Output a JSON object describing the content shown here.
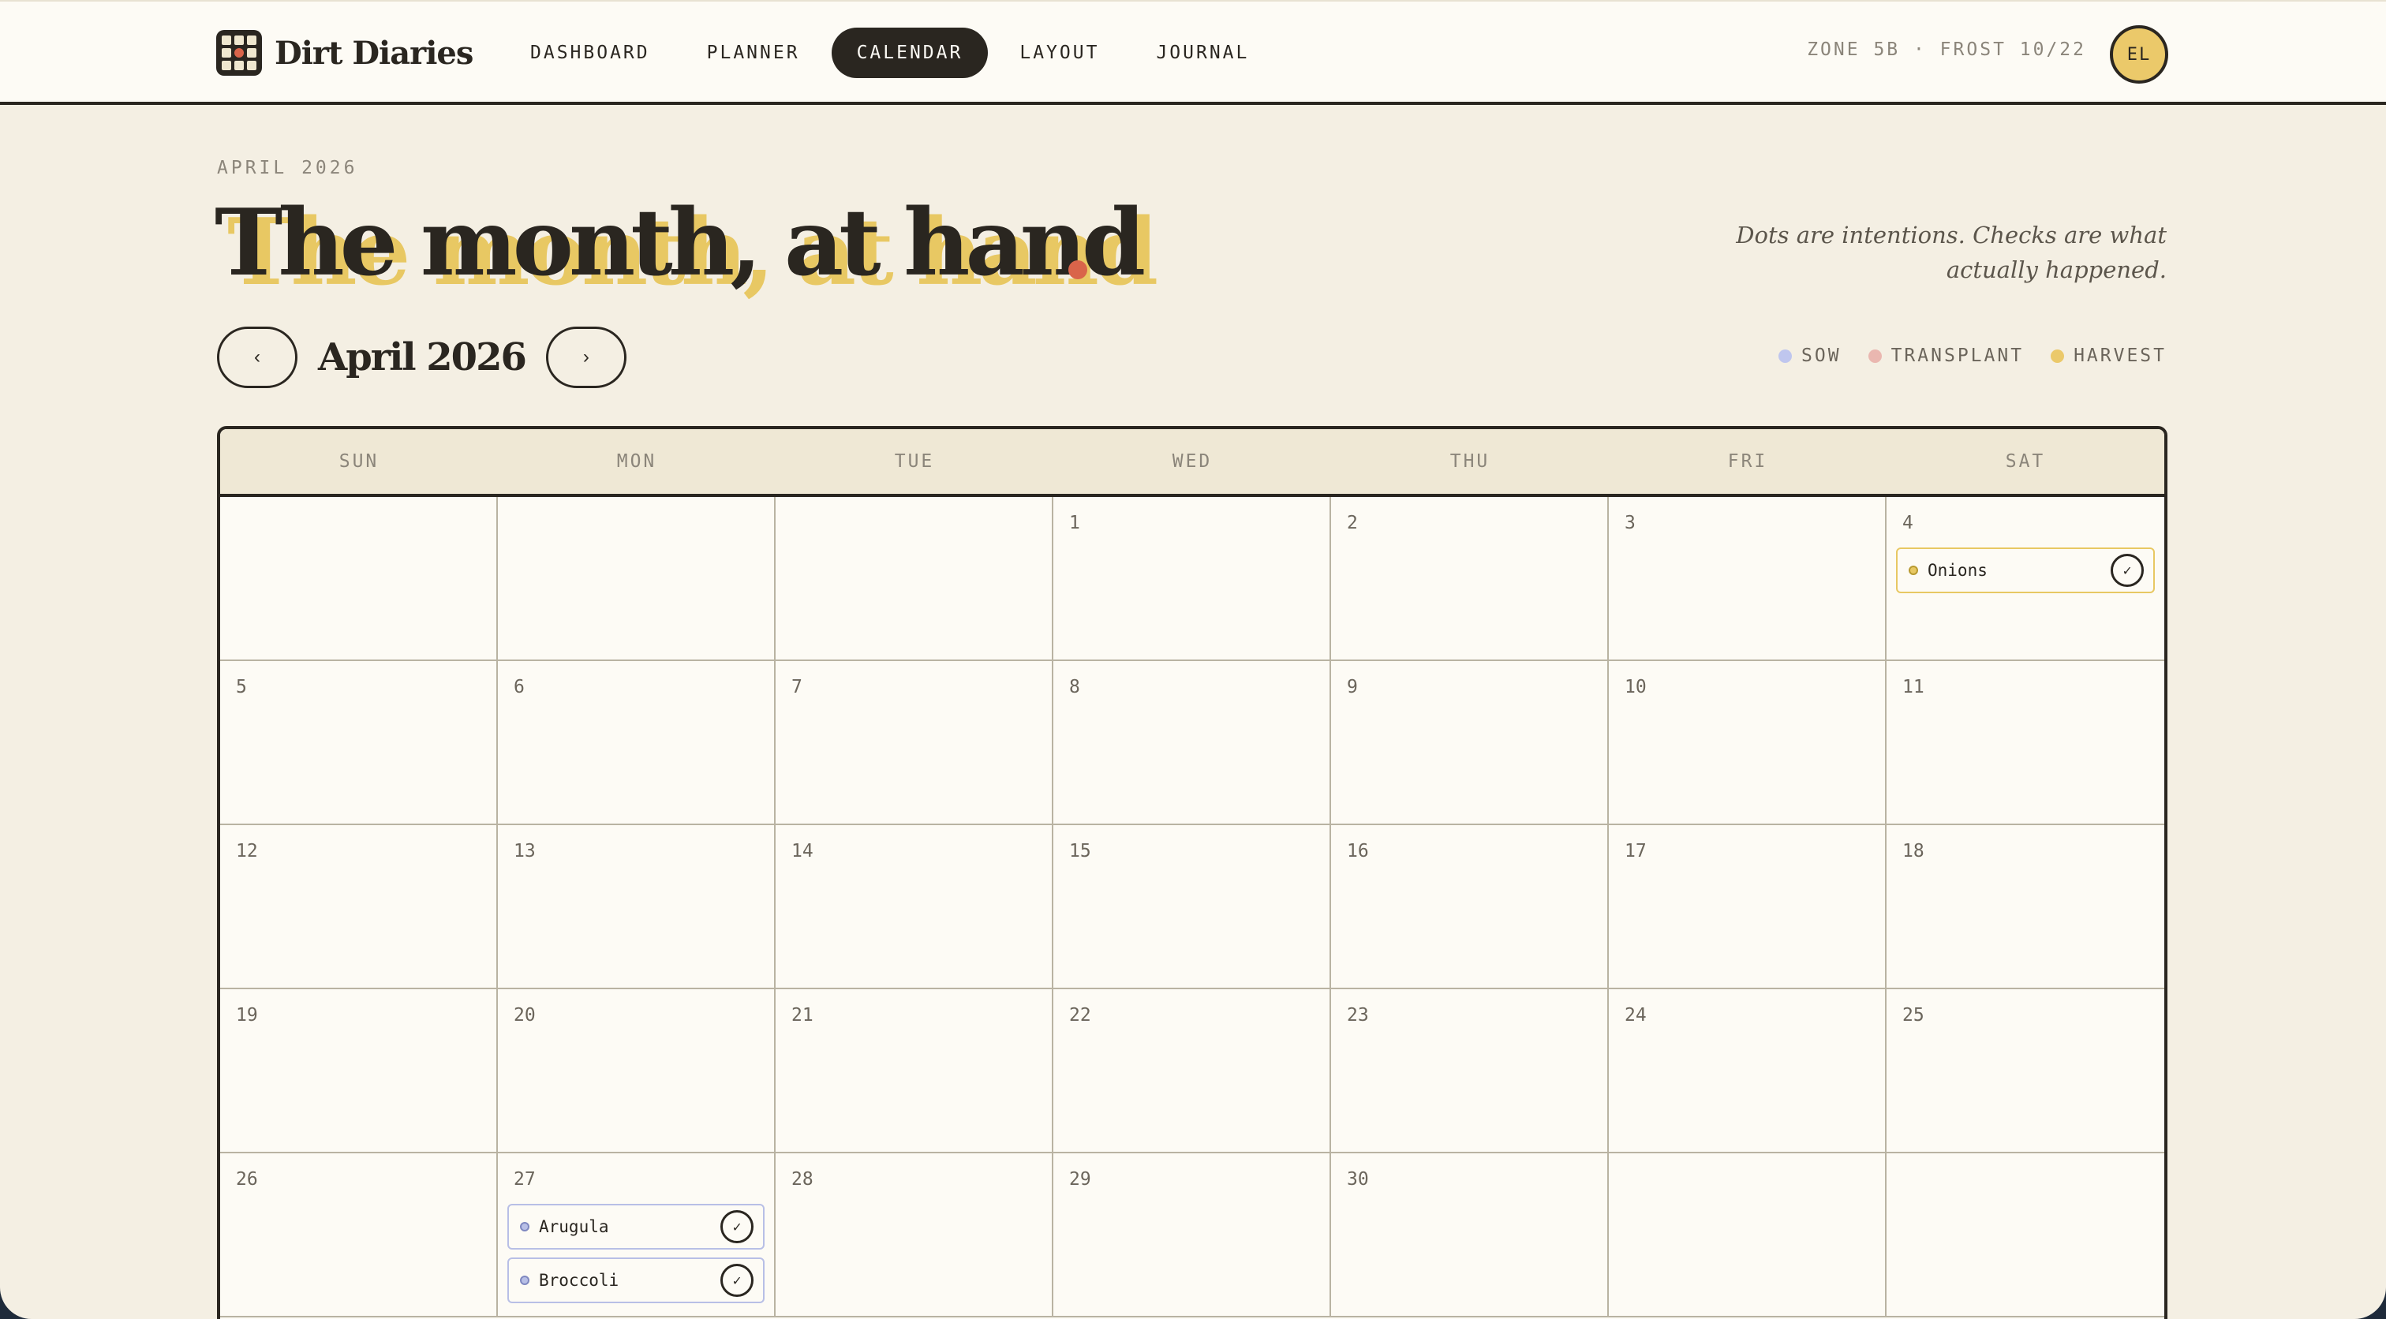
{
  "brand": {
    "name": "Dirt Diaries",
    "logo_icon": "grid-logo-icon"
  },
  "nav": {
    "items": [
      {
        "label": "DASHBOARD",
        "active": false
      },
      {
        "label": "PLANNER",
        "active": false
      },
      {
        "label": "CALENDAR",
        "active": true
      },
      {
        "label": "LAYOUT",
        "active": false
      },
      {
        "label": "JOURNAL",
        "active": false
      }
    ]
  },
  "zone": "ZONE 5B · FROST 10/22",
  "avatar": "EL",
  "header": {
    "eyebrow": "APRIL 2026",
    "title": "The month, at hand",
    "subtitle": "Dots are intentions. Checks are what actually happened."
  },
  "month_nav": {
    "prev": "‹",
    "label": "April 2026",
    "next": "›"
  },
  "legend": [
    {
      "label": "SOW",
      "color": "#bfc6ee"
    },
    {
      "label": "TRANSPLANT",
      "color": "#eab7b0"
    },
    {
      "label": "HARVEST",
      "color": "#ebc96a"
    }
  ],
  "colors": {
    "sow": "#b8bfe6",
    "transplant": "#e8b0a8",
    "harvest": "#e8c863",
    "accent": "#d9644a",
    "ink": "#2a2620"
  },
  "calendar": {
    "weekdays": [
      "SUN",
      "MON",
      "TUE",
      "WED",
      "THU",
      "FRI",
      "SAT"
    ],
    "cells": [
      {
        "day": "",
        "events": []
      },
      {
        "day": "",
        "events": []
      },
      {
        "day": "",
        "events": []
      },
      {
        "day": "1",
        "events": []
      },
      {
        "day": "2",
        "events": []
      },
      {
        "day": "3",
        "events": []
      },
      {
        "day": "4",
        "events": [
          {
            "name": "Onions",
            "type": "harvest",
            "done": true
          }
        ]
      },
      {
        "day": "5",
        "events": []
      },
      {
        "day": "6",
        "events": []
      },
      {
        "day": "7",
        "events": []
      },
      {
        "day": "8",
        "events": []
      },
      {
        "day": "9",
        "events": []
      },
      {
        "day": "10",
        "events": []
      },
      {
        "day": "11",
        "events": []
      },
      {
        "day": "12",
        "events": []
      },
      {
        "day": "13",
        "events": []
      },
      {
        "day": "14",
        "events": []
      },
      {
        "day": "15",
        "events": []
      },
      {
        "day": "16",
        "events": []
      },
      {
        "day": "17",
        "events": []
      },
      {
        "day": "18",
        "events": []
      },
      {
        "day": "19",
        "events": []
      },
      {
        "day": "20",
        "events": []
      },
      {
        "day": "21",
        "events": []
      },
      {
        "day": "22",
        "events": []
      },
      {
        "day": "23",
        "events": []
      },
      {
        "day": "24",
        "events": []
      },
      {
        "day": "25",
        "events": []
      },
      {
        "day": "26",
        "events": []
      },
      {
        "day": "27",
        "events": [
          {
            "name": "Arugula",
            "type": "sow",
            "done": true
          },
          {
            "name": "Broccoli",
            "type": "sow",
            "done": true
          }
        ]
      },
      {
        "day": "28",
        "events": []
      },
      {
        "day": "29",
        "events": []
      },
      {
        "day": "30",
        "events": []
      },
      {
        "day": "",
        "events": []
      },
      {
        "day": "",
        "events": []
      }
    ],
    "check_glyph": "✓"
  }
}
